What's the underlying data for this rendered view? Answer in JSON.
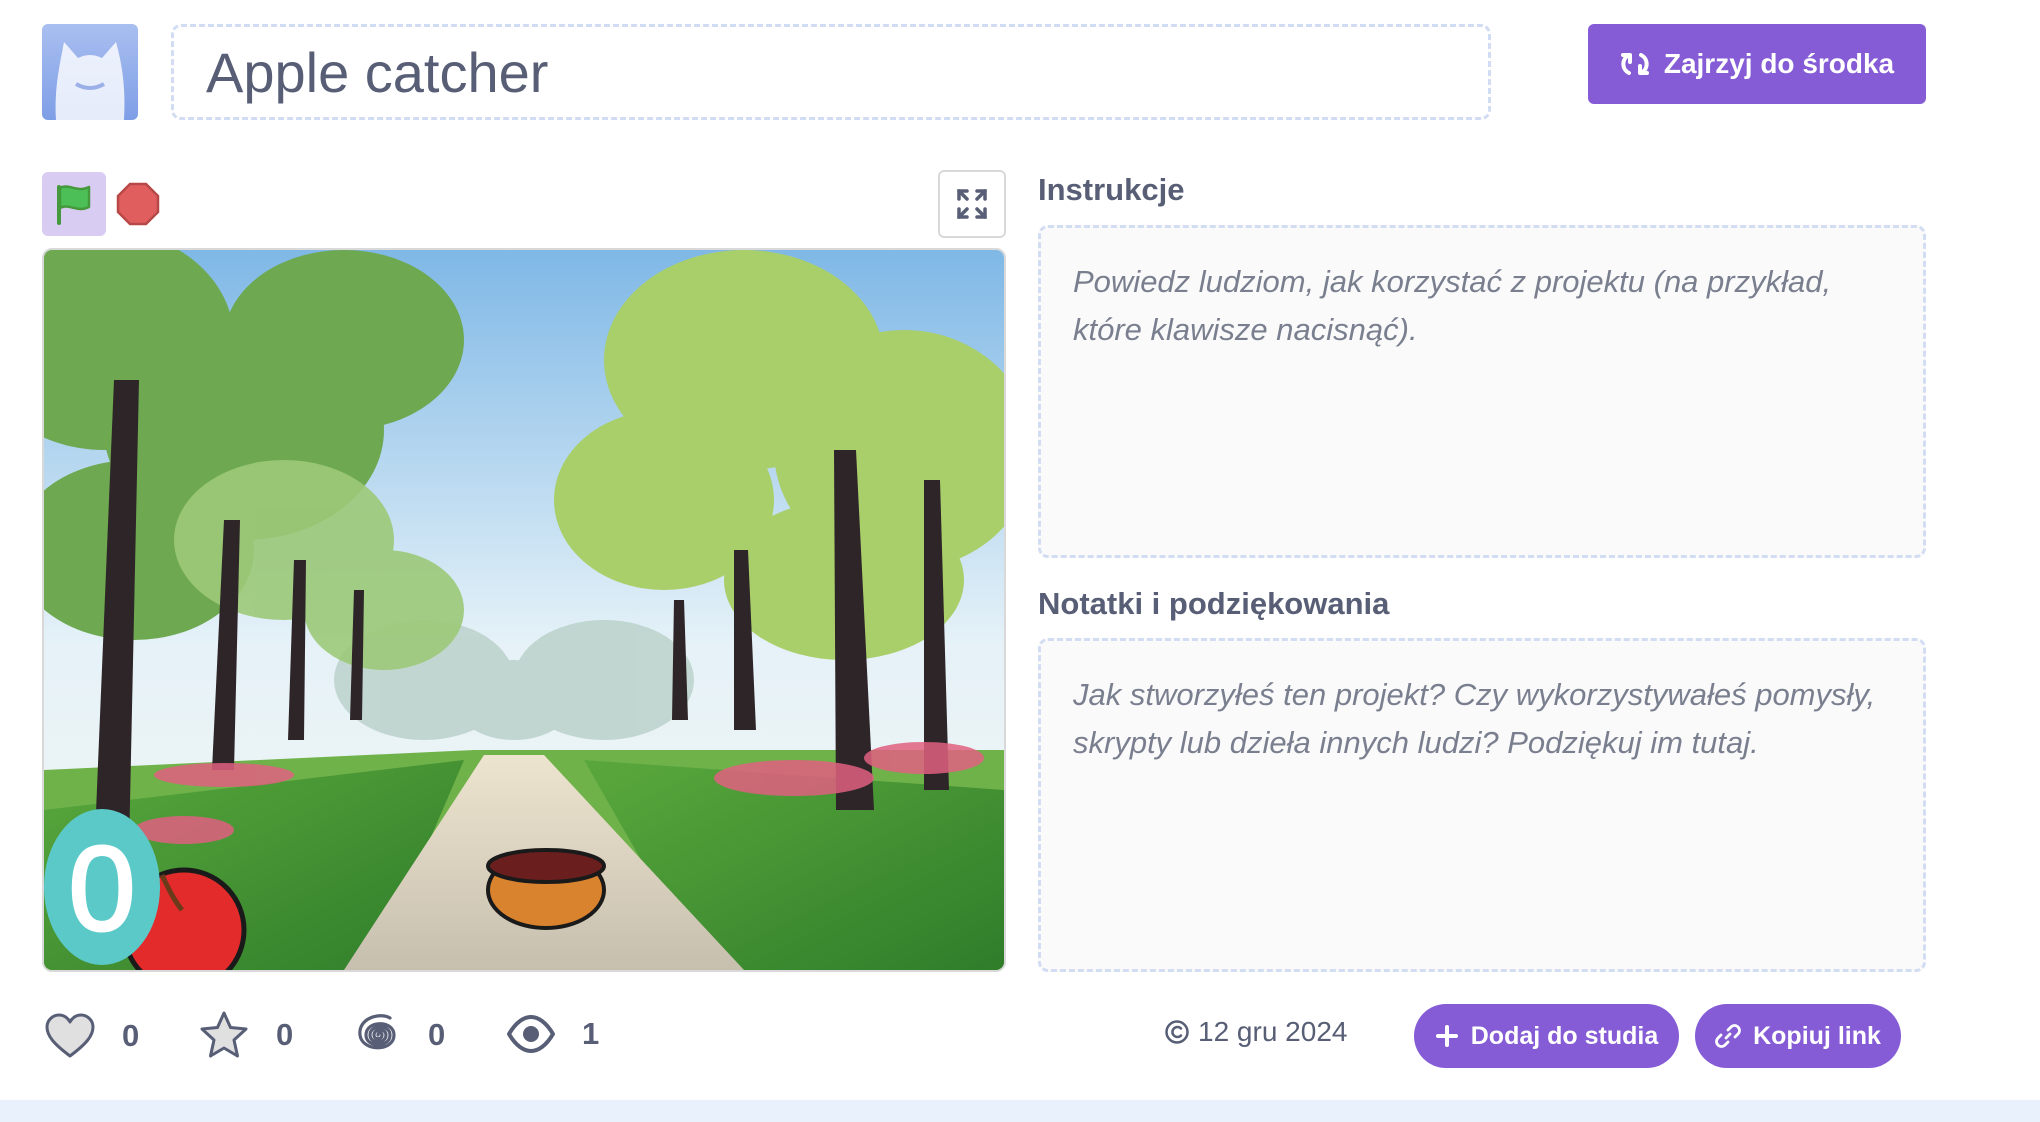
{
  "project": {
    "title": "Apple catcher",
    "see_inside_label": "Zajrzyj do środka"
  },
  "instructions": {
    "heading": "Instrukcje",
    "placeholder": "Powiedz ludziom, jak korzystać z projektu (na przykład, które klawisze nacisnąć)."
  },
  "notes": {
    "heading": "Notatki i podziękowania",
    "placeholder": "Jak stworzyłeś ten projekt? Czy wykorzystywałeś pomysły, skrypty lub dzieła innych ludzi? Podziękuj im tutaj."
  },
  "stage": {
    "score": "0"
  },
  "stats": {
    "loves": "0",
    "favorites": "0",
    "remixes": "0",
    "views": "1"
  },
  "footer": {
    "date": "12 gru 2024",
    "add_to_studio_label": "Dodaj do studia",
    "copy_link_label": "Kopiuj link"
  },
  "colors": {
    "accent": "#855cd6",
    "text": "#575e75",
    "flag_bg": "#d9ccf3",
    "stop": "#e05e5e",
    "score": "#5cc9c9"
  },
  "icons": {
    "see_inside": "remix-arrows-icon",
    "flag": "green-flag-icon",
    "stop": "stop-sign-icon",
    "fullscreen": "fullscreen-icon",
    "love": "heart-icon",
    "favorite": "star-icon",
    "remix": "remix-spiral-icon",
    "views": "eye-icon",
    "copyright": "copyright-icon",
    "add": "plus-icon",
    "link": "link-icon"
  }
}
